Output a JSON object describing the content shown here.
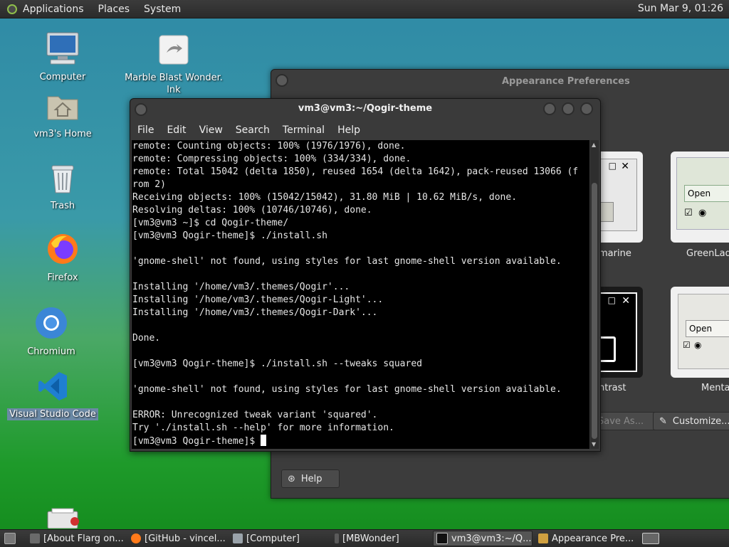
{
  "top_panel": {
    "menus": [
      "Applications",
      "Places",
      "System"
    ],
    "clock": "Sun Mar  9, 01:26"
  },
  "desktop": {
    "icons": [
      {
        "label": "Computer",
        "icon": "computer-icon"
      },
      {
        "label": "Marble Blast Wonder.\nlnk",
        "icon": "link-file-icon"
      },
      {
        "label": "vm3's Home",
        "icon": "home-folder-icon"
      },
      {
        "label": "Trash",
        "icon": "trash-icon"
      },
      {
        "label": "Firefox",
        "icon": "firefox-icon"
      },
      {
        "label": "Chromium",
        "icon": "chromium-icon"
      },
      {
        "label": "Visual Studio Code",
        "icon": "vscode-icon"
      }
    ]
  },
  "appearance": {
    "title": "Appearance Preferences",
    "themes": [
      {
        "name": "marine"
      },
      {
        "name": "GreenLaq"
      },
      {
        "name": "ntrast"
      },
      {
        "name": "Menta"
      }
    ],
    "card_open_label": "Open",
    "save_as_label": "Save As...",
    "customize_label": "Customize...",
    "help_label": "Help"
  },
  "terminal": {
    "title": "vm3@vm3:~/Qogir-theme",
    "menu": [
      "File",
      "Edit",
      "View",
      "Search",
      "Terminal",
      "Help"
    ],
    "lines": [
      "remote: Counting objects: 100% (1976/1976), done.",
      "remote: Compressing objects: 100% (334/334), done.",
      "remote: Total 15042 (delta 1850), reused 1654 (delta 1642), pack-reused 13066 (f",
      "rom 2)",
      "Receiving objects: 100% (15042/15042), 31.80 MiB | 10.62 MiB/s, done.",
      "Resolving deltas: 100% (10746/10746), done.",
      "[vm3@vm3 ~]$ cd Qogir-theme/",
      "[vm3@vm3 Qogir-theme]$ ./install.sh",
      "",
      "'gnome-shell' not found, using styles for last gnome-shell version available.",
      "",
      "Installing '/home/vm3/.themes/Qogir'...",
      "Installing '/home/vm3/.themes/Qogir-Light'...",
      "Installing '/home/vm3/.themes/Qogir-Dark'...",
      "",
      "Done.",
      "",
      "[vm3@vm3 Qogir-theme]$ ./install.sh --tweaks squared",
      "",
      "'gnome-shell' not found, using styles for last gnome-shell version available.",
      "",
      "ERROR: Unrecognized tweak variant 'squared'.",
      "Try './install.sh --help' for more information."
    ],
    "prompt": "[vm3@vm3 Qogir-theme]$ "
  },
  "taskbar": {
    "tasks": [
      {
        "label": "[About Flarg on..."
      },
      {
        "label": "[GitHub - vincel..."
      },
      {
        "label": "[Computer]"
      },
      {
        "label": "[MBWonder]"
      },
      {
        "label": "vm3@vm3:~/Q..."
      },
      {
        "label": "Appearance Pre..."
      }
    ]
  }
}
